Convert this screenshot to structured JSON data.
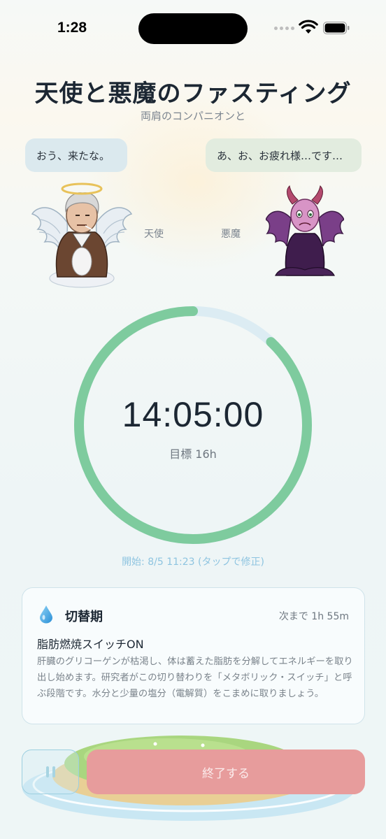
{
  "status_bar": {
    "time": "1:28"
  },
  "header": {
    "title": "天使と悪魔のファスティング",
    "subtitle": "両肩のコンパニオンと"
  },
  "companions": {
    "angel": {
      "speech": "おう、来たな。",
      "label": "天使"
    },
    "devil": {
      "speech": "あ、お、お疲れ様…です…",
      "label": "悪魔"
    }
  },
  "timer": {
    "elapsed": "14:05:00",
    "goal_label": "目標 16h",
    "progress_fraction": 0.8802,
    "start_text": "開始: 8/5 11:23 (タップで修正)",
    "progress_color": "#7ecb9e",
    "track_color": "#dcecf3"
  },
  "phase_card": {
    "icon": "water-drop-icon",
    "phase_name": "切替期",
    "remaining": "次まで 1h 55m",
    "heading": "脂肪燃焼スイッチON",
    "body": "肝臓のグリコーゲンが枯渇し、体は蓄えた脂肪を分解してエネルギーを取り出し始めます。研究者がこの切り替わりを「メタボリック・スイッチ」と呼ぶ段階です。水分と少量の塩分（電解質）をこまめに取りましょう。"
  },
  "actions": {
    "pause_icon": "pause-icon",
    "end_label": "終了する",
    "end_color": "#e79c9c"
  }
}
